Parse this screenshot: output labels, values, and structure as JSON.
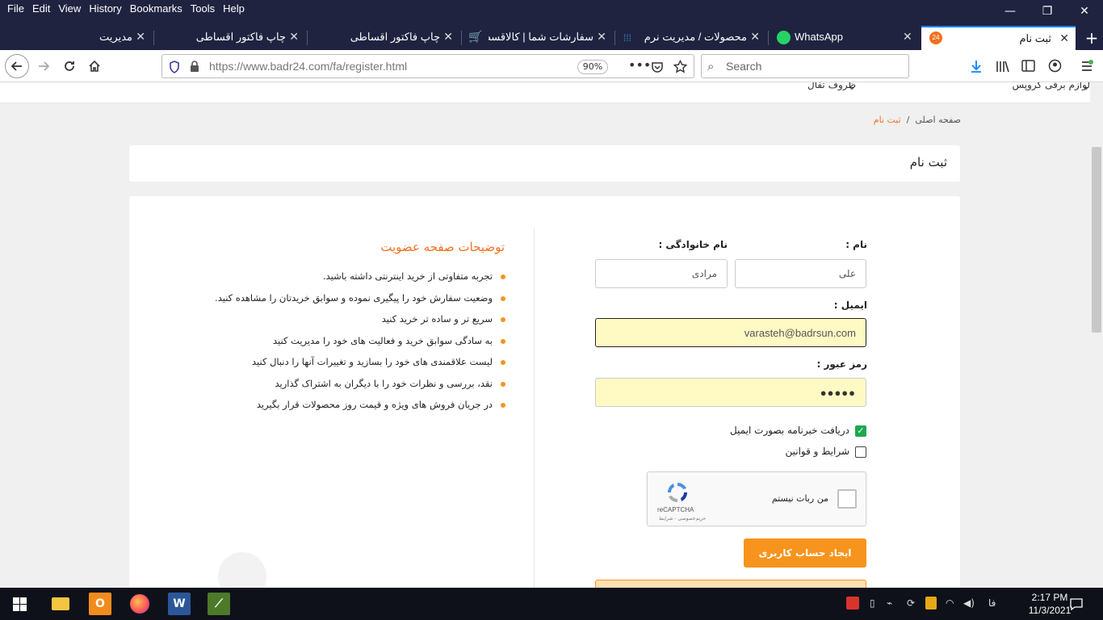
{
  "menubar": {
    "items": [
      "File",
      "Edit",
      "View",
      "History",
      "Bookmarks",
      "Tools",
      "Help"
    ]
  },
  "window_controls": {
    "minimize": "—",
    "restore": "❐",
    "close": "✕"
  },
  "tabs": [
    {
      "label": "ثبت نام",
      "active": true
    },
    {
      "label": "WhatsApp"
    },
    {
      "label": "محصولات / مدیریت نرم اف"
    },
    {
      "label": "سفارشات شما | کالاقسطی"
    },
    {
      "label": "چاپ فاکتور اقساطی"
    },
    {
      "label": "چاپ فاکتور اقساطی"
    },
    {
      "label": "مدیریت"
    }
  ],
  "navbar": {
    "url_host": "https://www.badr24.com",
    "url_path": "/fa/register.html",
    "zoom": "90%",
    "search_placeholder": "Search"
  },
  "site": {
    "top_menu": [
      "لوازم برقی کروپس",
      "ظروف تفال"
    ],
    "breadcrumb": {
      "home": "صفحه اصلی",
      "sep": "/",
      "current": "ثبت نام"
    },
    "page_title": "ثبت نام"
  },
  "form": {
    "first_name_label": "نام :",
    "first_name_value": "علی",
    "last_name_label": "نام خانوادگی :",
    "last_name_value": "مرادی",
    "email_label": "ایمیل :",
    "email_value": "varasteh@badrsun.com",
    "password_label": "رمز عبور :",
    "password_value": "●●●●●",
    "newsletter_label": "دریافت خبرنامه بصورت ایمیل",
    "newsletter_checked": true,
    "terms_label": "شرایط و قوانین",
    "terms_checked": false,
    "captcha_text": "من ربات نیستم",
    "captcha_brand": "reCAPTCHA",
    "captcha_terms": "حریم‌خصوصی - شرایط",
    "submit_label": "ایجاد حساب کاربری"
  },
  "description": {
    "title": "توضیحات صفحه عضویت",
    "items": [
      "تجربه متفاوتی از خرید اینترنتی داشته باشید.",
      "وضعیت سفارش خود را پیگیری نموده و سوابق خریدتان را مشاهده کنید.",
      "سریع تر و ساده تر خرید کنید",
      "به سادگی سوابق خرید و فعالیت های خود را مدیریت کنید",
      "لیست علاقمندی های خود را بسازید و تغییرات آنها را دنبال کنید",
      "نقد، بررسی و نظرات خود را با دیگران به اشتراک گذارید",
      "در جریان فروش های ویژه و قیمت روز محصولات قرار بگیرید"
    ]
  },
  "taskbar": {
    "lang": "فا",
    "time": "2:17 PM",
    "date": "11/3/2021"
  },
  "colors": {
    "accent": "#f7941d",
    "title_orange": "#f37021",
    "chrome_dark": "#202340",
    "check_green": "#1fa84f"
  }
}
